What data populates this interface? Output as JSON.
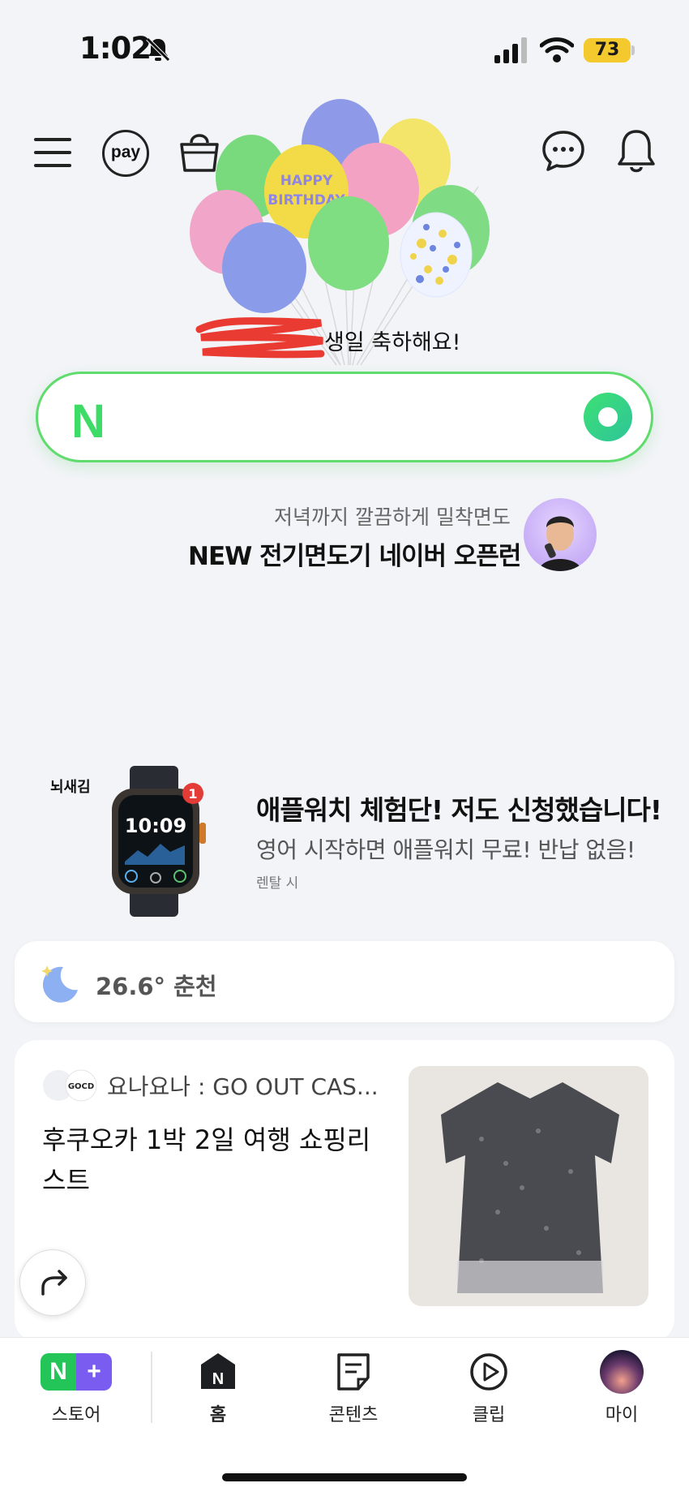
{
  "status_bar": {
    "time": "1:02",
    "battery": "73"
  },
  "top_bar": {
    "pay_label": "pay"
  },
  "birthday": {
    "message": "생일 축하해요!"
  },
  "search": {
    "logo": "N"
  },
  "promo": {
    "subtitle": "저녁까지 깔끔하게 밀착면도",
    "title": "NEW 전기면도기 네이버 오픈런"
  },
  "ad": {
    "brand": "뇌새김",
    "watch_time": "10:09",
    "badge": "1",
    "title": "애플워치 체험단! 저도 신청했습니다!",
    "description": "영어 시작하면 애플워치 무료! 반납 없음!",
    "note": "렌탈 시"
  },
  "weather": {
    "text": "26.6° 춘천"
  },
  "feed": {
    "avatar_text": "GOCD",
    "source": "요나요나 : GO OUT CAS...",
    "title": "후쿠오카 1박 2일 여행 쇼핑리스트"
  },
  "bottom_nav": {
    "items": [
      {
        "label": "스토어"
      },
      {
        "label": "홈"
      },
      {
        "label": "콘텐츠"
      },
      {
        "label": "클립"
      },
      {
        "label": "마이"
      }
    ]
  },
  "colors": {
    "accent": "#3ddc66",
    "store_green": "#23c559",
    "store_purple": "#7b5cf0",
    "battery": "#f4c92e"
  }
}
